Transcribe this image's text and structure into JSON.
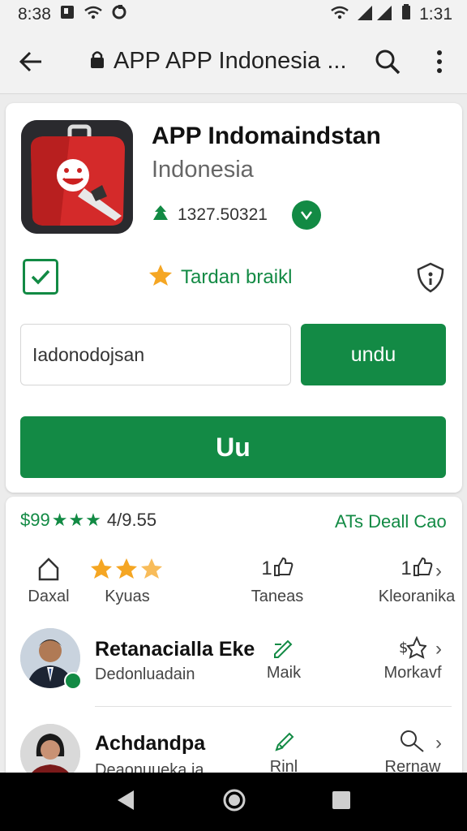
{
  "status_bar": {
    "time_left": "8:38",
    "time_right": "1:31"
  },
  "toolbar": {
    "title": "APP APP Indonesia ..."
  },
  "app": {
    "name": "APP Indomaindstan",
    "subtitle": "Indonesia",
    "downloads": "1327.50321"
  },
  "rating_label": "Tardan braikl",
  "input": {
    "value": "Iadonodojsan"
  },
  "buttons": {
    "unduh": "undu",
    "install": "Uu"
  },
  "ratings": {
    "price": "$99",
    "stars": "★★★",
    "score": "4/9.55",
    "all_link": "ATs Deall Cao"
  },
  "stats": [
    {
      "label": "Daxal"
    },
    {
      "label": "Kyuas"
    },
    {
      "value": "1",
      "label": "Taneas"
    },
    {
      "value": "1",
      "label": "Kleoranika"
    }
  ],
  "reviews": [
    {
      "name": "Retanacialla Eke",
      "subtitle": "Dedonluadain",
      "action1": "Maik",
      "action2": "Morkavf"
    },
    {
      "name": "Achdandpa",
      "subtitle": "Deaonuueka ja",
      "action1": "Rinl",
      "action2": "Rernaw"
    }
  ],
  "colors": {
    "accent": "#138a45",
    "star": "#f5a623",
    "app_icon": "#d42a2a"
  }
}
